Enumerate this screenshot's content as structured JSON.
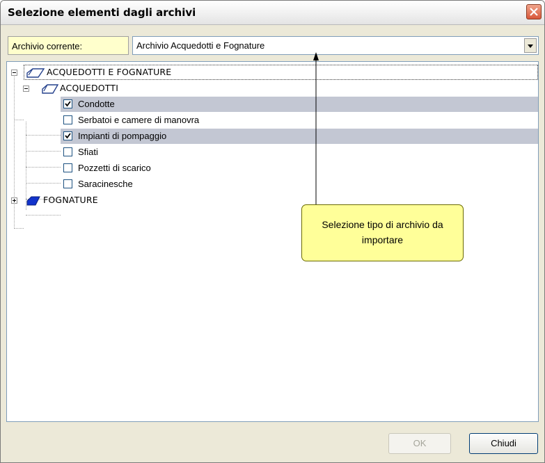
{
  "window": {
    "title": "Selezione elementi dagli archivi"
  },
  "archive": {
    "label": "Archivio corrente:",
    "selected": "Archivio Acquedotti e Fognature"
  },
  "tree": {
    "root": {
      "label": "ACQUEDOTTI E FOGNATURE",
      "expanded": true,
      "children": [
        {
          "label": "ACQUEDOTTI",
          "expanded": true,
          "items": [
            {
              "label": "Condotte",
              "checked": true,
              "selected": true
            },
            {
              "label": "Serbatoi e camere di manovra",
              "checked": false,
              "selected": false
            },
            {
              "label": "Impianti di pompaggio",
              "checked": true,
              "selected": true
            },
            {
              "label": "Sfiati",
              "checked": false,
              "selected": false
            },
            {
              "label": "Pozzetti di scarico",
              "checked": false,
              "selected": false
            },
            {
              "label": "Saracinesche",
              "checked": false,
              "selected": false
            }
          ]
        },
        {
          "label": "FOGNATURE",
          "expanded": false
        }
      ]
    }
  },
  "callout": {
    "text": "Selezione tipo di archivio da importare"
  },
  "buttons": {
    "ok": "OK",
    "close": "Chiudi"
  },
  "colors": {
    "selection": "#c3c7d3",
    "tooltip": "#ffff99",
    "label_bg": "#ffffcc",
    "fognature_icon": "#1133cc"
  }
}
